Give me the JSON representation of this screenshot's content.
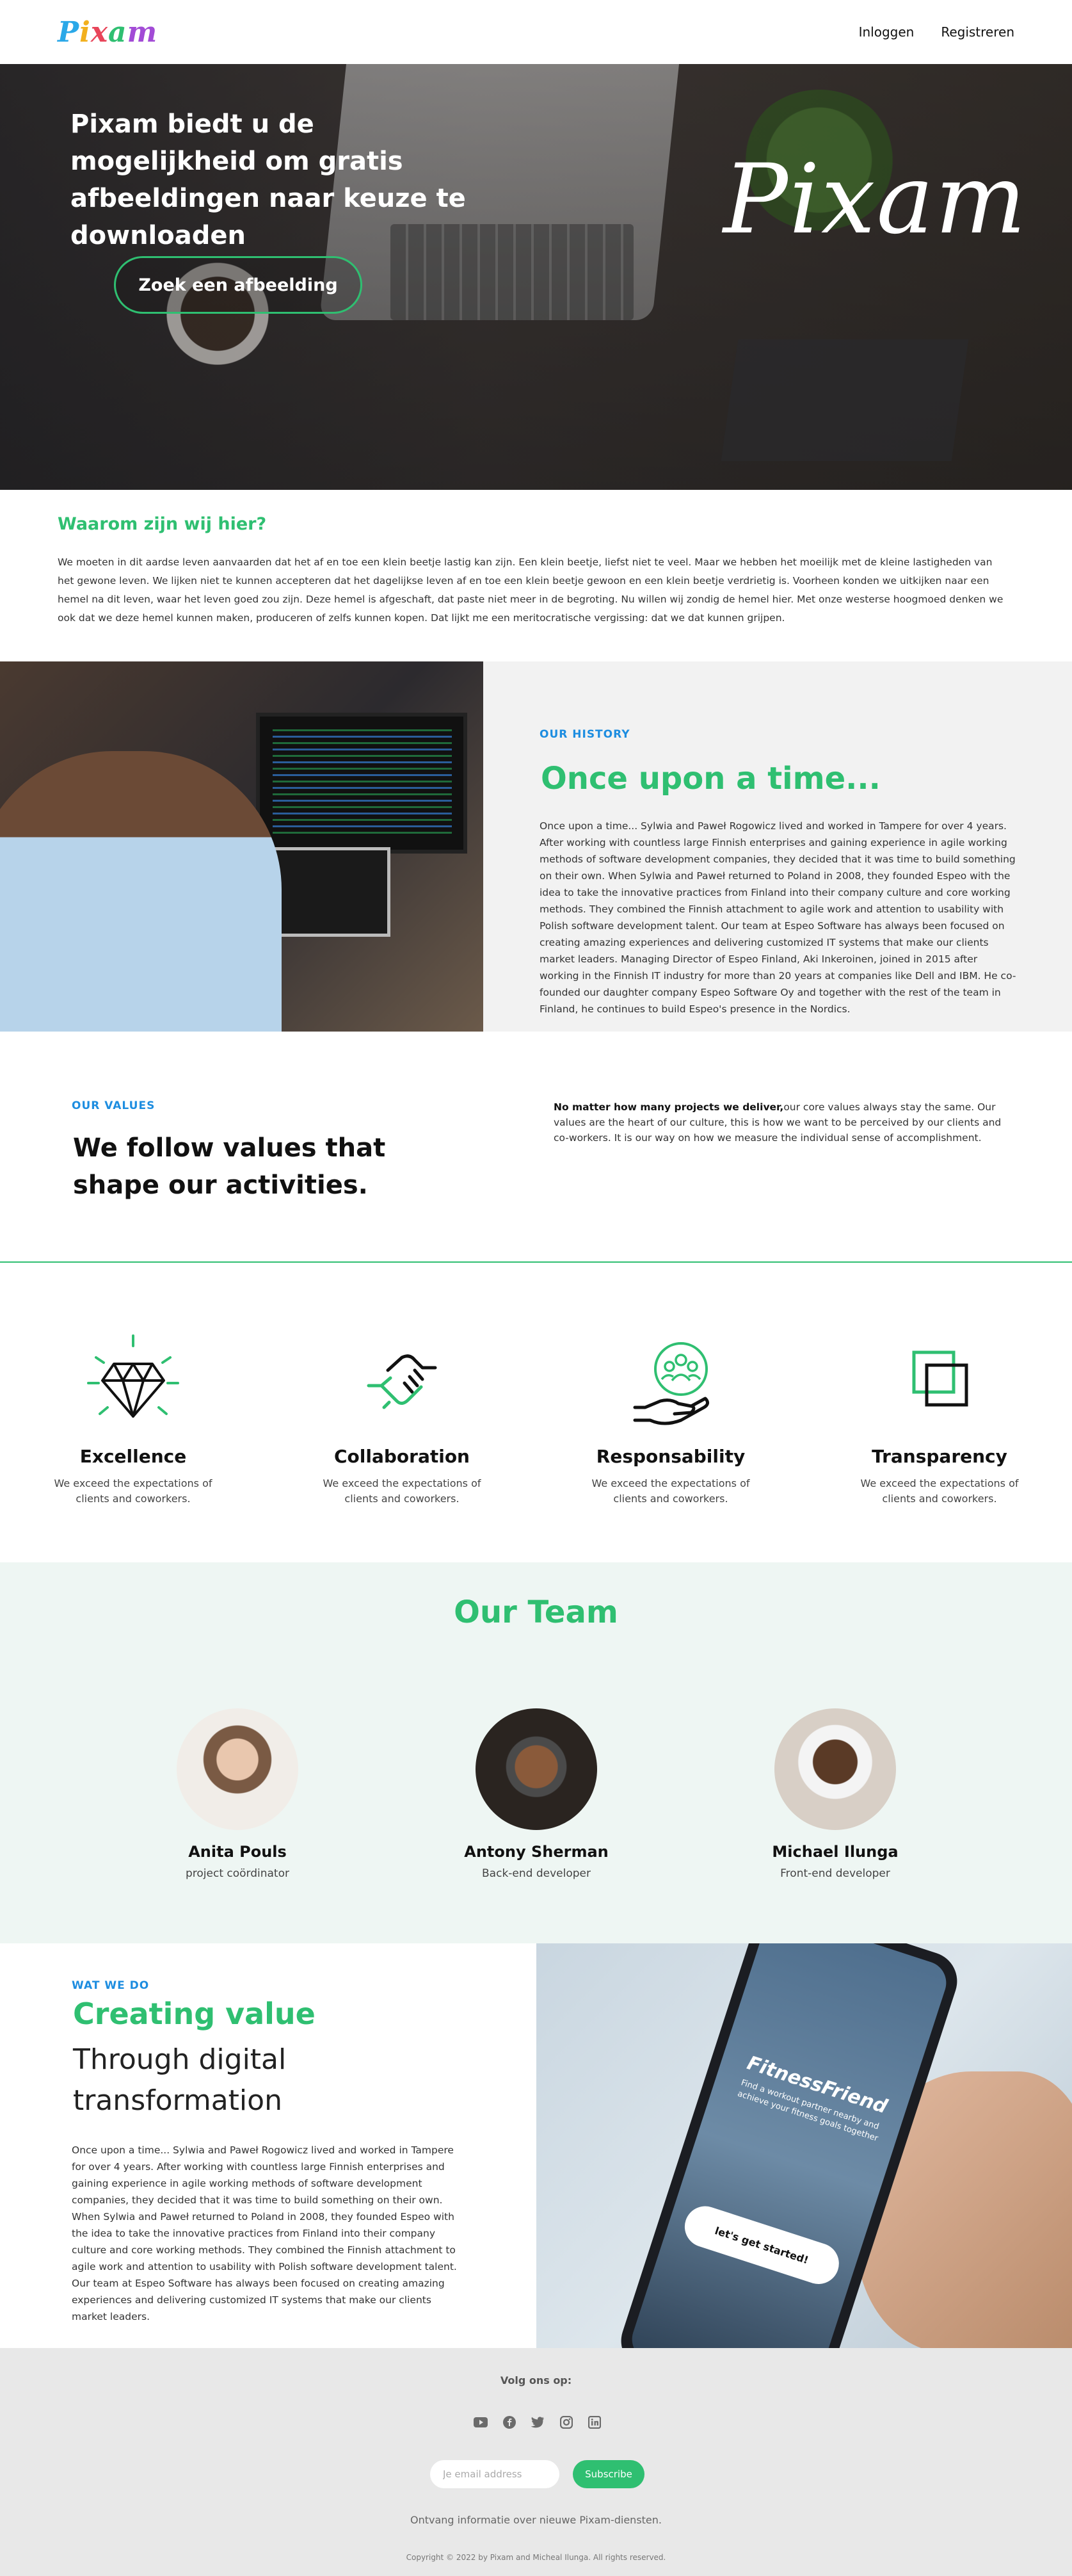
{
  "header": {
    "logo_letters": [
      "P",
      "i",
      "x",
      "a",
      "m"
    ],
    "nav": [
      "Inloggen",
      "Registreren"
    ]
  },
  "hero": {
    "title": "Pixam biedt u de mogelijkheid om gratis afbeeldingen naar keuze te downloaden",
    "button": "Zoek een afbeelding",
    "signature": "Pixam"
  },
  "why": {
    "title": "Waarom zijn wij hier?",
    "text": "We moeten in dit aardse leven aanvaarden dat het af en toe een klein beetje lastig kan zijn. Een klein beetje, liefst niet te veel. Maar we hebben het moeilijk met de kleine lastigheden van het gewone leven. We lijken niet te kunnen accepteren dat het dagelijkse leven af en toe een klein beetje gewoon en een klein beetje verdrietig is. Voorheen konden we uitkijken naar een hemel na dit leven, waar het leven goed zou zijn. Deze hemel is afgeschaft, dat paste niet meer in de begroting. Nu willen wij zondig de hemel hier. Met onze westerse hoogmoed denken we ook dat we deze hemel kunnen maken, produceren of zelfs kunnen kopen. Dat lijkt me een meritocratische vergissing: dat we dat kunnen grijpen."
  },
  "history": {
    "label": "OUR HISTORY",
    "title": "Once upon a time...",
    "text": "Once upon a time... Sylwia and Paweł Rogowicz lived and worked in Tampere for over 4 years. After working with countless large Finnish enterprises and gaining experience in agile working methods of software development companies, they decided that it was time to build something on their own. When Sylwia and Paweł returned to Poland in 2008, they founded Espeo with the idea to take the innovative practices from Finland into their company culture and core working methods. They combined the Finnish attachment to agile work and attention to usability with Polish software development talent. Our team at Espeo Software has always been focused on creating amazing experiences and delivering customized IT systems that make our clients market leaders. Managing Director of Espeo Finland, Aki Inkeroinen, joined in 2015 after working in the Finnish IT industry for more than 20 years at companies like Dell and IBM. He co-founded our daughter company Espeo Software Oy and together with the rest of the team in Finland, he continues to build Espeo's presence in the Nordics."
  },
  "values": {
    "label": "OUR VALUES",
    "title": "We follow values that shape our activities.",
    "text_bold": "No matter how many projects we deliver,",
    "text": "our core values always stay the same. Our values are the heart of our culture, this is how we want to be perceived by our clients and co-workers. It is our way on how we measure the individual sense of accomplishment.",
    "items": [
      {
        "name": "Excellence",
        "desc": "We exceed the expectations of clients and coworkers.",
        "icon": "diamond-icon"
      },
      {
        "name": "Collaboration",
        "desc": "We exceed the expectations of clients and coworkers.",
        "icon": "handshake-icon"
      },
      {
        "name": "Responsability",
        "desc": "We exceed the expectations of clients and coworkers.",
        "icon": "team-hand-icon"
      },
      {
        "name": "Transparency",
        "desc": "We exceed the expectations of clients and coworkers.",
        "icon": "squares-icon"
      }
    ]
  },
  "team": {
    "title": "Our Team",
    "members": [
      {
        "name": "Anita Pouls",
        "role": "project coördinator"
      },
      {
        "name": "Antony Sherman",
        "role": "Back-end developer"
      },
      {
        "name": "Michael Ilunga",
        "role": "Front-end developer"
      }
    ]
  },
  "what": {
    "label": "WAT WE DO",
    "title": "Creating value",
    "subtitle": "Through digital transformation",
    "text": "Once upon a time... Sylwia and Paweł Rogowicz lived and worked in Tampere for over 4 years. After working with countless large Finnish enterprises and gaining experience in agile working methods of software development companies, they decided that it was time to build something on their own. When Sylwia and Paweł returned to Poland in 2008, they founded Espeo with the idea to take the innovative practices from Finland into their company culture and core working methods. They combined the Finnish attachment to agile work and attention to usability with Polish software development talent. Our team at Espeo Software has always been focused on creating amazing experiences and delivering customized IT systems that make our clients market leaders.",
    "phone": {
      "brand": "FitnessFriend",
      "tagline": "Find a workout partner nearby and achieve your fitness goals together",
      "cta": "let's get started!"
    }
  },
  "footer": {
    "follow": "Volg ons op:",
    "social_icons": [
      "youtube-icon",
      "facebook-icon",
      "twitter-icon",
      "instagram-icon",
      "linkedin-icon"
    ],
    "email_placeholder": "Je email address",
    "subscribe": "Subscribe",
    "info": "Ontvang informatie over nieuwe Pixam-diensten.",
    "copyright": "Copyright © 2022 by Pixam and Micheal Ilunga. All rights reserved."
  },
  "colors": {
    "accent_green": "#2fbf71",
    "label_blue": "#1d8de0",
    "team_bg": "#eef6f3",
    "footer_bg": "#e8e8e8"
  }
}
